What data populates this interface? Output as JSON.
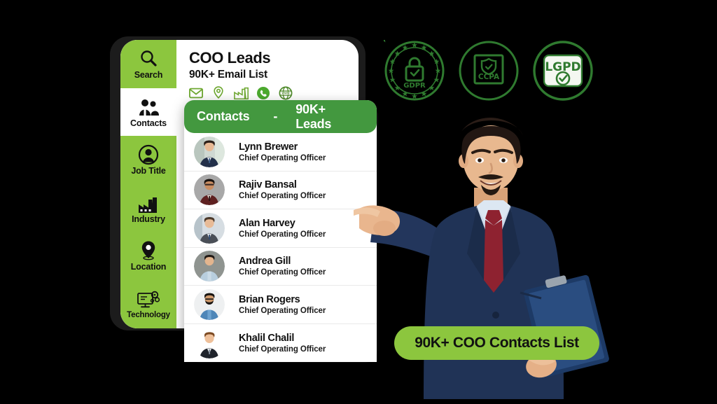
{
  "app": {
    "title": "COO Leads",
    "subtitle": "90K+ Email List",
    "header_icons": [
      {
        "name": "email-icon",
        "label": "Email"
      },
      {
        "name": "location-pin-icon",
        "label": "Location"
      },
      {
        "name": "industry-factory-icon",
        "label": "Industry"
      },
      {
        "name": "phone-icon",
        "label": "Phone"
      },
      {
        "name": "website-globe-icon",
        "label": "Website"
      }
    ]
  },
  "sidebar": {
    "items": [
      {
        "label": "Search",
        "icon": "search-icon",
        "active": true
      },
      {
        "label": "Contacts",
        "icon": "contacts-icon",
        "active": false
      },
      {
        "label": "Job Title",
        "icon": "job-title-icon",
        "active": true
      },
      {
        "label": "Industry",
        "icon": "industry-factory-icon",
        "active": true
      },
      {
        "label": "Location",
        "icon": "location-pin-icon",
        "active": true
      },
      {
        "label": "Technology",
        "icon": "technology-icon",
        "active": true
      }
    ]
  },
  "contacts_panel": {
    "title": "Contacts",
    "separator": "-",
    "count_label": "90K+ Leads",
    "rows": [
      {
        "name": "Lynn Brewer",
        "role": "Chief Operating Officer"
      },
      {
        "name": "Rajiv Bansal",
        "role": "Chief Operating Officer"
      },
      {
        "name": "Alan Harvey",
        "role": "Chief Operating Officer"
      },
      {
        "name": "Andrea Gill",
        "role": "Chief Operating Officer"
      },
      {
        "name": "Brian Rogers",
        "role": "Chief Operating Officer"
      },
      {
        "name": "Khalil Chalil",
        "role": "Chief Operating Officer"
      }
    ]
  },
  "badges": [
    {
      "label": "GDPR",
      "icon": "gdpr-badge-icon"
    },
    {
      "label": "CCPA",
      "icon": "ccpa-badge-icon"
    },
    {
      "label": "LGPD",
      "icon": "lgpd-badge-icon"
    }
  ],
  "cta": {
    "label": "90K+ COO Contacts List"
  },
  "person": {
    "alt": "businessman-pointing-photo"
  },
  "colors": {
    "background": "#000000",
    "accent_light_green": "#8CC63E",
    "accent_dark_green": "#43983F",
    "badge_green": "#2F7A2F",
    "card_white": "#FFFFFF",
    "text_dark": "#111111",
    "suit_navy": "#1F3357",
    "tie_red": "#8E2230"
  }
}
